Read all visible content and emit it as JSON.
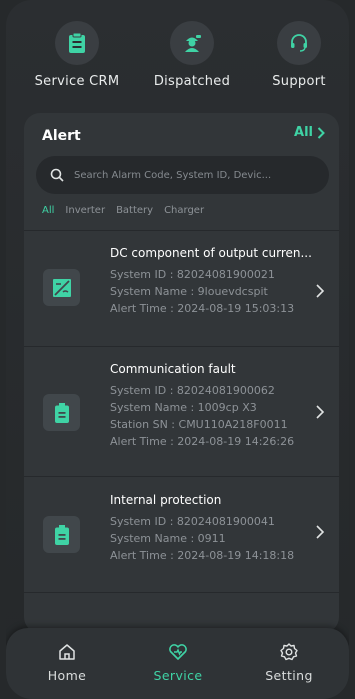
{
  "colors": {
    "accent": "#3fd3a5",
    "background": "#2b2e31",
    "card": "#323639"
  },
  "shortcuts": [
    {
      "label": "Service CRM",
      "icon": "clipboard-icon"
    },
    {
      "label": "Dispatched",
      "icon": "dispatch-worker-icon"
    },
    {
      "label": "Support",
      "icon": "headset-icon"
    }
  ],
  "alert": {
    "title": "Alert",
    "all_label": "All",
    "search_placeholder": "Search Alarm Code, System ID, Devic...",
    "filters": [
      "All",
      "Inverter",
      "Battery",
      "Charger"
    ],
    "active_filter": "All",
    "items": [
      {
        "title": "DC component of output curren...",
        "icon": "inverter-icon",
        "lines": [
          "System ID : 82024081900021",
          "System Name : 9louevdcspit",
          "Alert Time : 2024-08-19 15:03:13"
        ]
      },
      {
        "title": "Communication fault",
        "icon": "battery-icon",
        "lines": [
          "System ID : 82024081900062",
          "System Name : 1009cp X3",
          "Station SN : CMU110A218F0011",
          "Alert Time : 2024-08-19 14:26:26"
        ]
      },
      {
        "title": "Internal protection",
        "icon": "battery-icon",
        "lines": [
          "System ID : 82024081900041",
          "System Name : 0911",
          "Alert Time : 2024-08-19 14:18:18"
        ]
      }
    ]
  },
  "nav": [
    {
      "label": "Home",
      "icon": "home-icon"
    },
    {
      "label": "Service",
      "icon": "service-heart-icon",
      "active": true
    },
    {
      "label": "Setting",
      "icon": "gear-icon"
    }
  ]
}
